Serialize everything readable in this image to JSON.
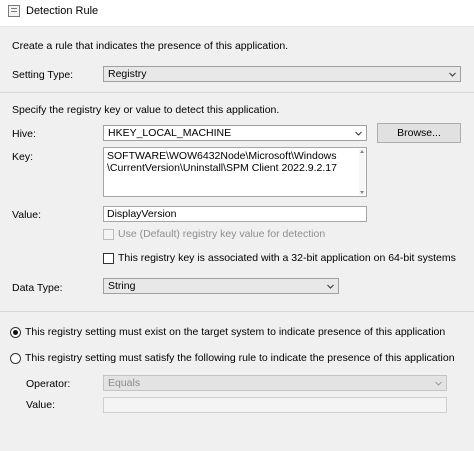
{
  "window": {
    "title": "Detection Rule"
  },
  "intro": "Create a rule that indicates the presence of this application.",
  "setting_type": {
    "label": "Setting Type:",
    "value": "Registry"
  },
  "specify_text": "Specify the registry key or value to detect this application.",
  "hive": {
    "label": "Hive:",
    "value": "HKEY_LOCAL_MACHINE",
    "browse_label": "Browse..."
  },
  "key": {
    "label": "Key:",
    "line1": "SOFTWARE\\WOW6432Node\\Microsoft\\Windows",
    "line2": "\\CurrentVersion\\Uninstall\\SPM Client 2022.9.2.17"
  },
  "value": {
    "label": "Value:",
    "value": "DisplayVersion"
  },
  "use_default": {
    "label": "Use (Default) registry key value for detection",
    "checked": false,
    "enabled": false
  },
  "is_32bit": {
    "label": "This registry key is associated with a 32-bit application on 64-bit systems",
    "checked": false
  },
  "data_type": {
    "label": "Data Type:",
    "value": "String"
  },
  "radio_exist": {
    "label": "This registry setting must exist on the target system to indicate presence of this application",
    "selected": true
  },
  "radio_rule": {
    "label": "This registry setting must satisfy the following rule to indicate the presence of this application",
    "selected": false
  },
  "operator": {
    "label": "Operator:",
    "value": "Equals"
  },
  "rule_value": {
    "label": "Value:",
    "value": ""
  },
  "colors": {
    "content_bg": "#f0f0f0",
    "border": "#a0a0a0",
    "disabled_text": "#8f8f8f"
  },
  "icons": {
    "app": "window-app-icon",
    "dropdown": "chevron-down-icon"
  }
}
